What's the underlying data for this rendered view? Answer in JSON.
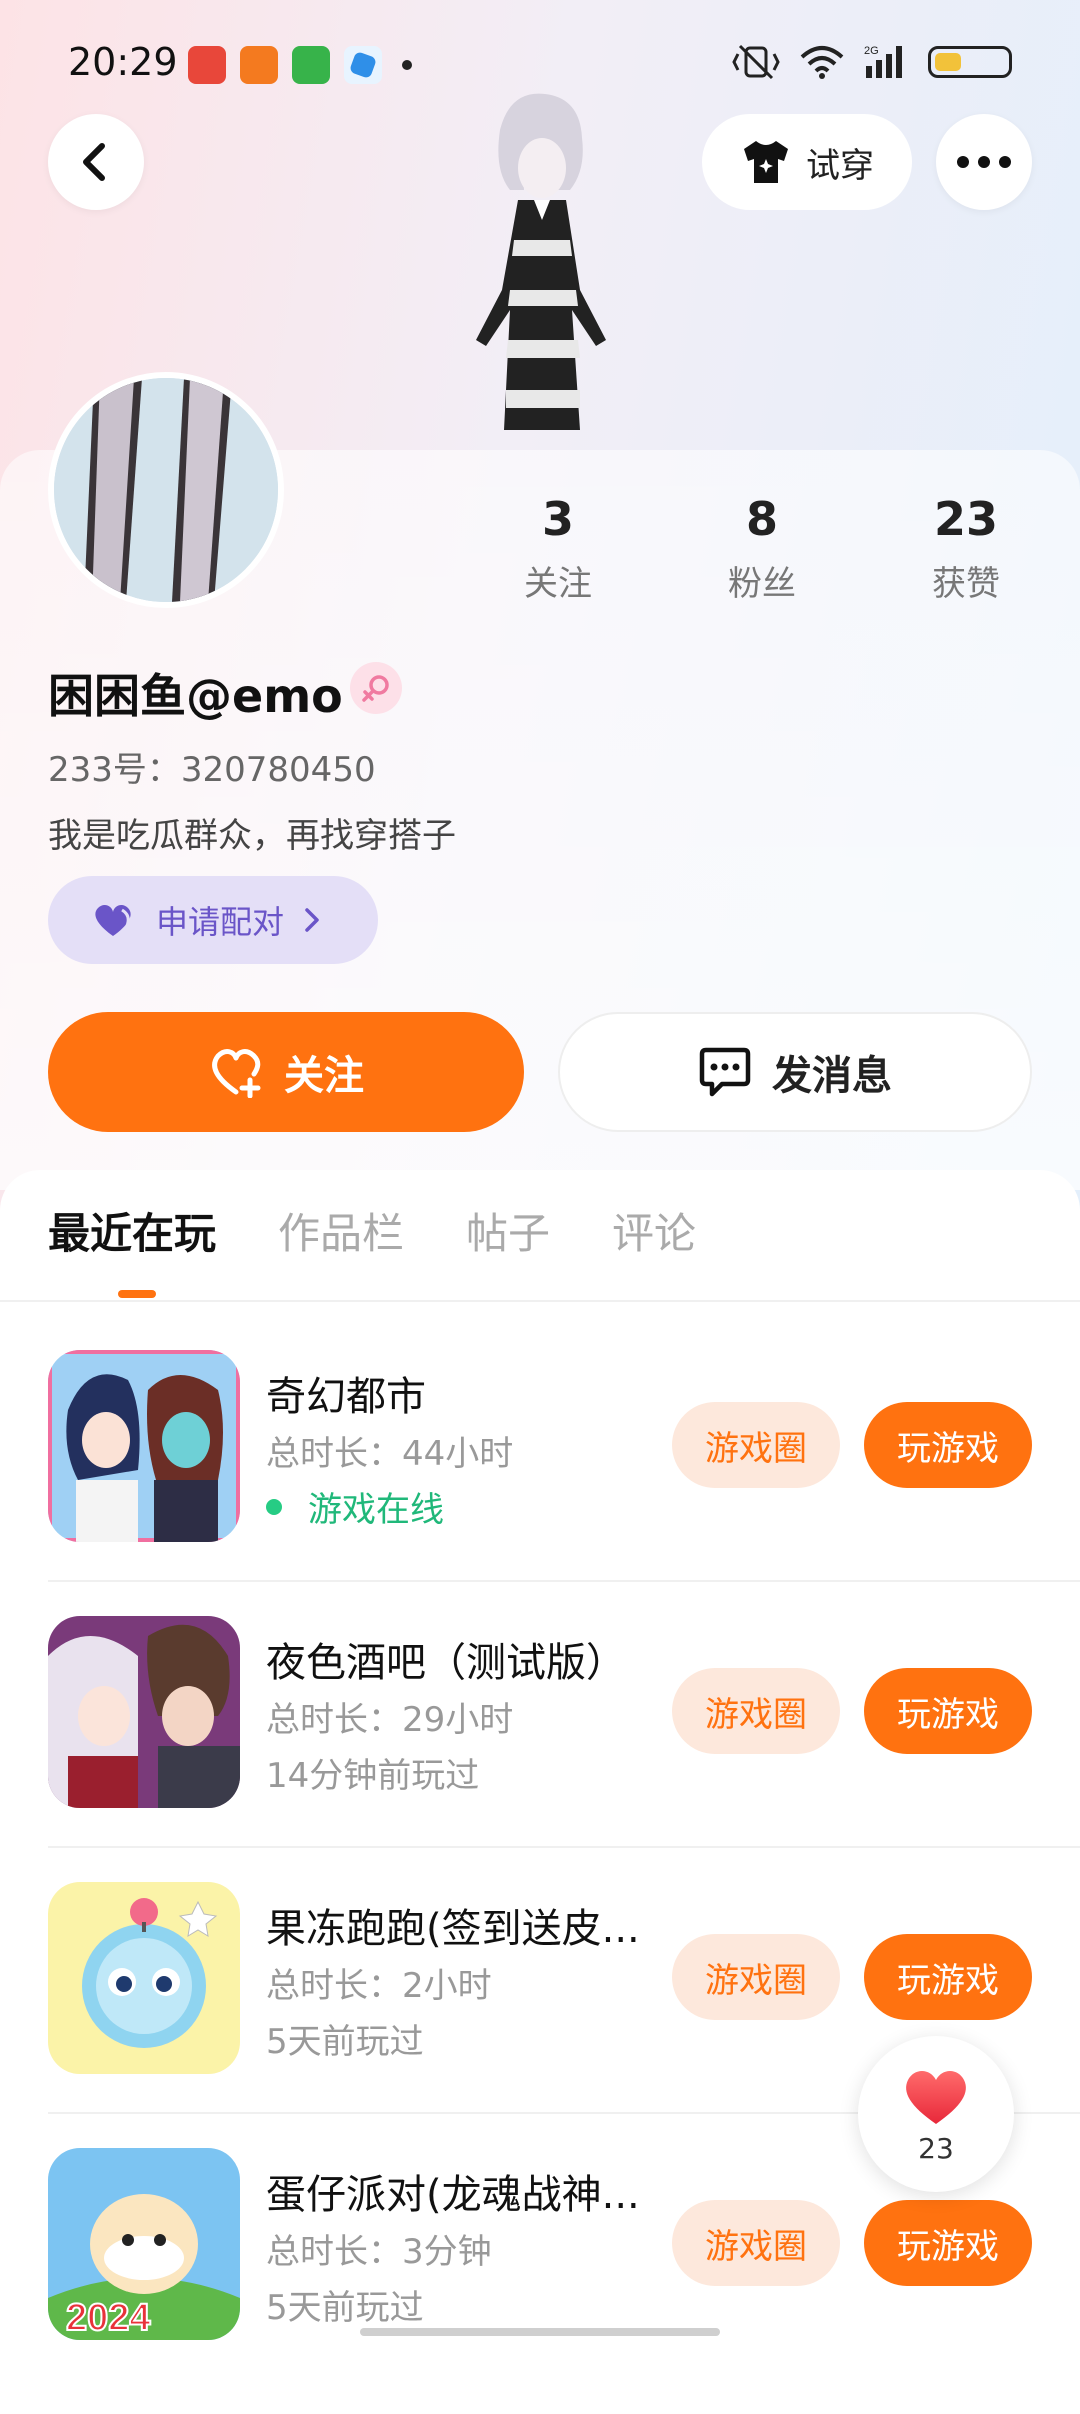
{
  "status_bar": {
    "time": "20:29"
  },
  "header": {
    "try_on_label": "试穿"
  },
  "profile": {
    "name": "困困鱼@emo",
    "uid": "233号：320780450",
    "bio": "我是吃瓜群众，再找穿搭子",
    "match_label": "申请配对",
    "stats": [
      {
        "num": "3",
        "label": "关注"
      },
      {
        "num": "8",
        "label": "粉丝"
      },
      {
        "num": "23",
        "label": "获赞"
      }
    ]
  },
  "actions": {
    "follow_label": "关注",
    "message_label": "发消息"
  },
  "tabs": [
    {
      "label": "最近在玩",
      "active": true
    },
    {
      "label": "作品栏",
      "active": false
    },
    {
      "label": "帖子",
      "active": false
    },
    {
      "label": "评论",
      "active": false
    }
  ],
  "games": [
    {
      "title": "奇幻都市",
      "duration": "总时长：44小时",
      "status": "游戏在线",
      "online": true,
      "circle_label": "游戏圈",
      "play_label": "玩游戏"
    },
    {
      "title": "夜色酒吧（测试版）",
      "duration": "总时长：29小时",
      "status": "14分钟前玩过",
      "online": false,
      "circle_label": "游戏圈",
      "play_label": "玩游戏"
    },
    {
      "title": "果冻跑跑(签到送皮...",
      "duration": "总时长：2小时",
      "status": "5天前玩过",
      "online": false,
      "circle_label": "游戏圈",
      "play_label": "玩游戏"
    },
    {
      "title": "蛋仔派对(龙魂战神...",
      "duration": "总时长：3分钟",
      "status": "5天前玩过",
      "online": false,
      "circle_label": "游戏圈",
      "play_label": "玩游戏"
    }
  ],
  "game4_icon_text": "2024",
  "like_float": {
    "count": "23"
  },
  "colors": {
    "accent": "#ff7210",
    "online": "#20b87a",
    "match": "#6a55c8"
  }
}
